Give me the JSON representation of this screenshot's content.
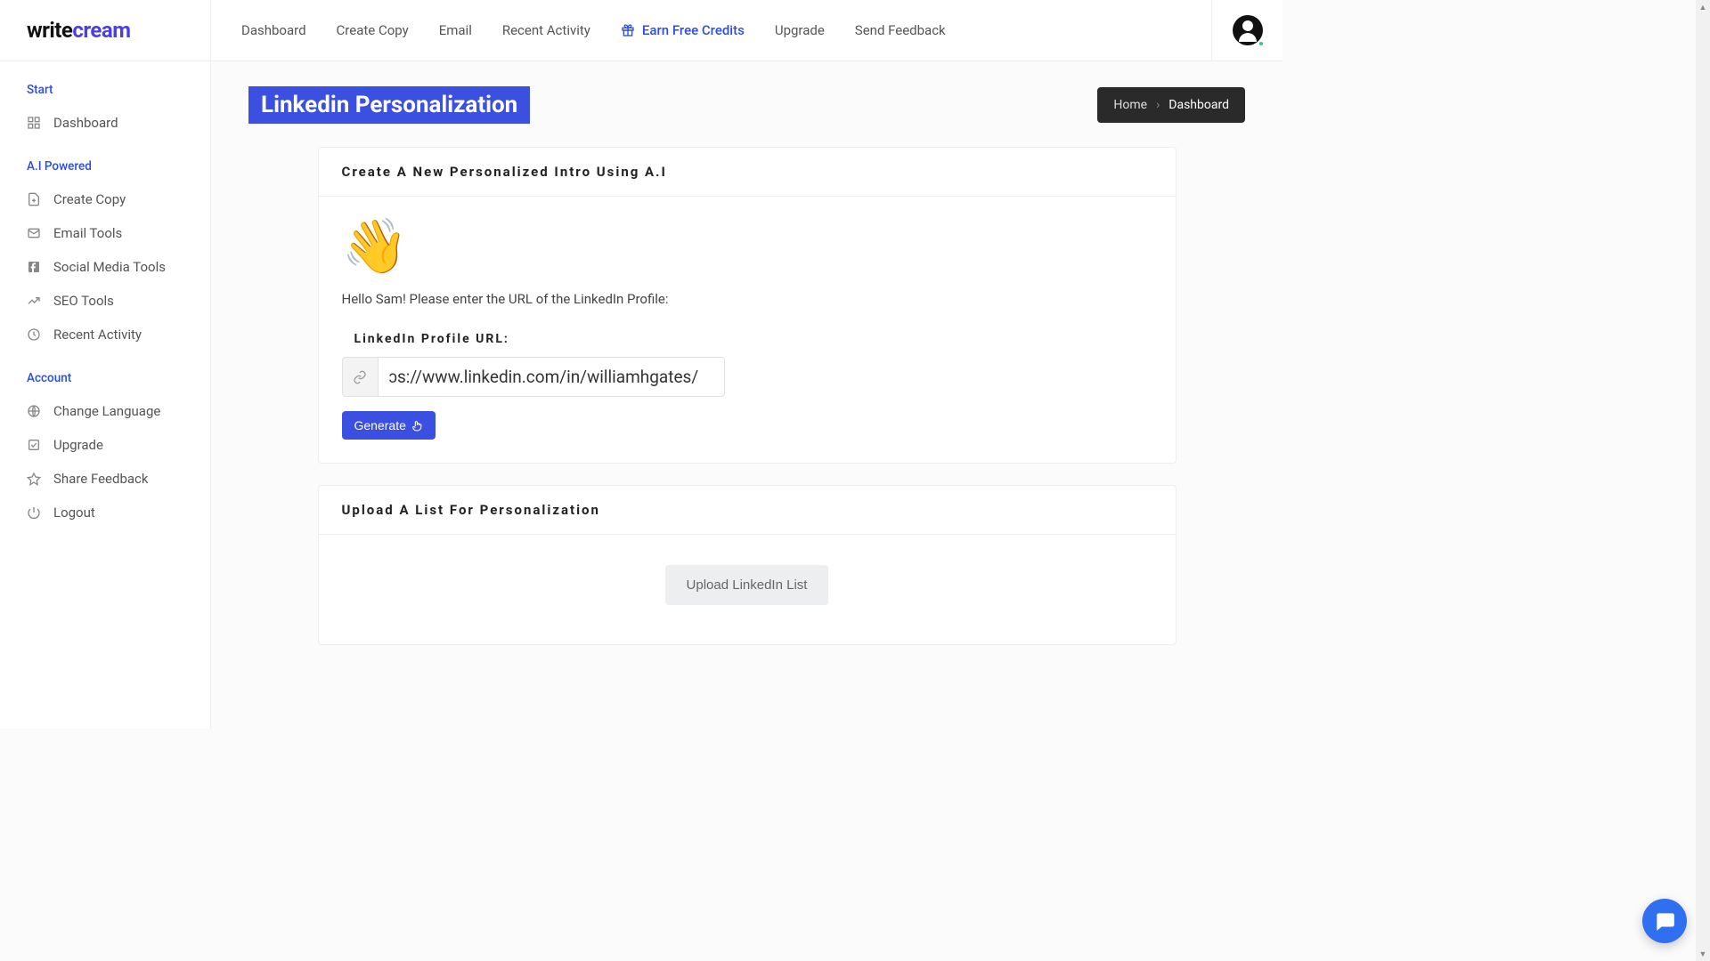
{
  "logo": {
    "part1": "write",
    "part2": "cream"
  },
  "topnav": {
    "dashboard": "Dashboard",
    "create_copy": "Create Copy",
    "email": "Email",
    "recent_activity": "Recent Activity",
    "earn_credits": "Earn Free Credits",
    "upgrade": "Upgrade",
    "send_feedback": "Send Feedback"
  },
  "sidebar": {
    "group_start": "Start",
    "dashboard": "Dashboard",
    "group_ai": "A.I Powered",
    "create_copy": "Create Copy",
    "email_tools": "Email Tools",
    "social_media_tools": "Social Media Tools",
    "seo_tools": "SEO Tools",
    "recent_activity": "Recent Activity",
    "group_account": "Account",
    "change_language": "Change Language",
    "upgrade": "Upgrade",
    "share_feedback": "Share Feedback",
    "logout": "Logout"
  },
  "page": {
    "title": "Linkedin Personalization",
    "breadcrumb_home": "Home",
    "breadcrumb_sep": "›",
    "breadcrumb_current": "Dashboard"
  },
  "card_intro": {
    "header": "Create A New Personalized Intro Using A.I",
    "wave": "👋",
    "hello": "Hello Sam! Please enter the URL of the LinkedIn Profile:",
    "field_label": "LinkedIn Profile URL:",
    "input_value": "ɔs://www.linkedin.com/in/williamhgates/",
    "generate_label": "Generate"
  },
  "card_upload": {
    "header": "Upload A List For Personalization",
    "button": "Upload LinkedIn List"
  }
}
